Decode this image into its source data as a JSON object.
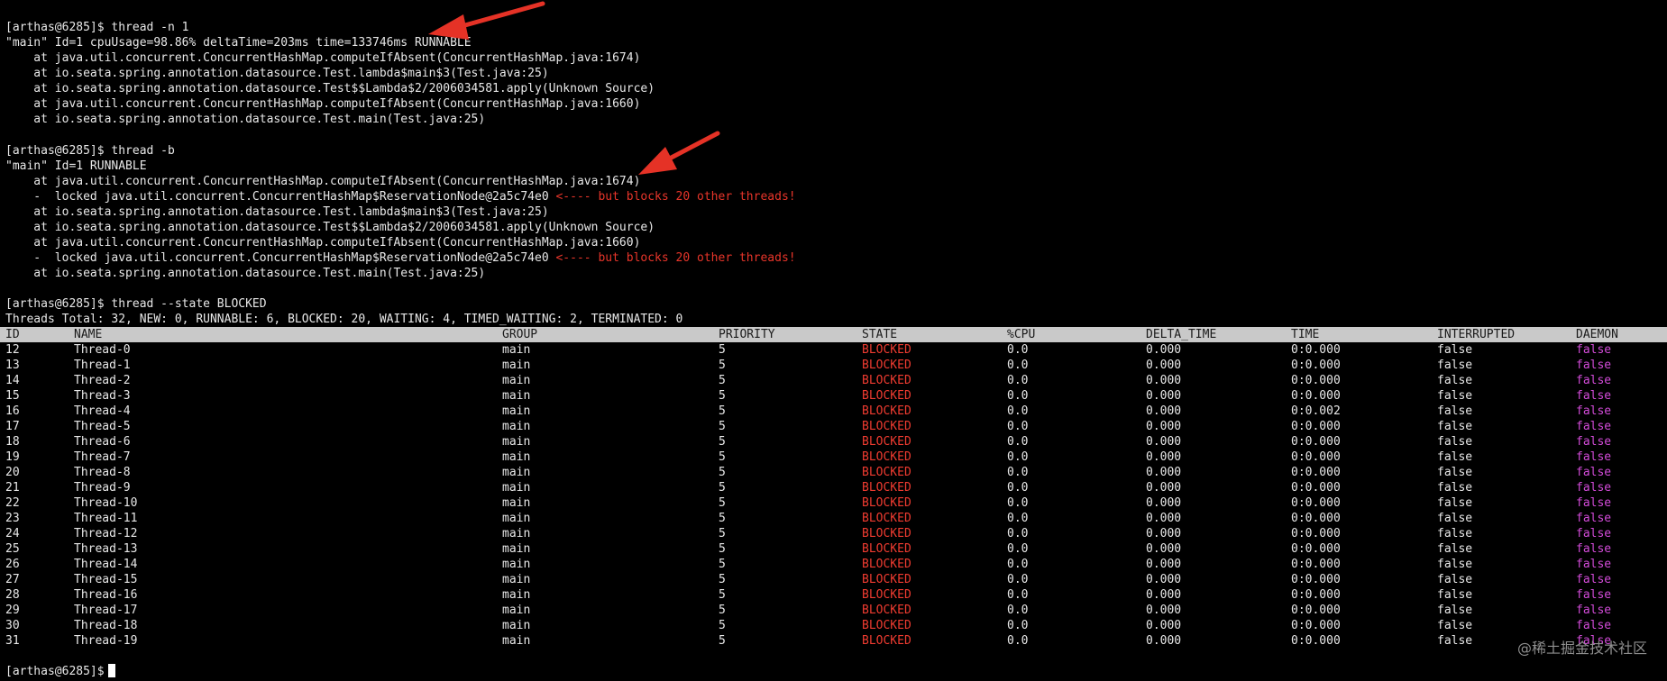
{
  "terminal": {
    "section1": {
      "prompt": "[arthas@6285]$ thread -n 1",
      "lines": [
        "\"main\" Id=1 cpuUsage=98.86% deltaTime=203ms time=133746ms RUNNABLE",
        "    at java.util.concurrent.ConcurrentHashMap.computeIfAbsent(ConcurrentHashMap.java:1674)",
        "    at io.seata.spring.annotation.datasource.Test.lambda$main$3(Test.java:25)",
        "    at io.seata.spring.annotation.datasource.Test$$Lambda$2/2006034581.apply(Unknown Source)",
        "    at java.util.concurrent.ConcurrentHashMap.computeIfAbsent(ConcurrentHashMap.java:1660)",
        "    at io.seata.spring.annotation.datasource.Test.main(Test.java:25)"
      ]
    },
    "section2": {
      "prompt": "[arthas@6285]$ thread -b",
      "line0": "\"main\" Id=1 RUNNABLE",
      "line1": "    at java.util.concurrent.ConcurrentHashMap.computeIfAbsent(ConcurrentHashMap.java:1674)",
      "line2": "    -  locked java.util.concurrent.ConcurrentHashMap$ReservationNode@2a5c74e0 ",
      "line2_warn": "<---- but blocks 20 other threads!",
      "line3": "    at io.seata.spring.annotation.datasource.Test.lambda$main$3(Test.java:25)",
      "line4": "    at io.seata.spring.annotation.datasource.Test$$Lambda$2/2006034581.apply(Unknown Source)",
      "line5": "    at java.util.concurrent.ConcurrentHashMap.computeIfAbsent(ConcurrentHashMap.java:1660)",
      "line6": "    -  locked java.util.concurrent.ConcurrentHashMap$ReservationNode@2a5c74e0 ",
      "line6_warn": "<---- but blocks 20 other threads!",
      "line7": "    at io.seata.spring.annotation.datasource.Test.main(Test.java:25)"
    },
    "section3": {
      "prompt": "[arthas@6285]$ thread --state BLOCKED",
      "summary": "Threads Total: 32, NEW: 0, RUNNABLE: 6, BLOCKED: 20, WAITING: 4, TIMED_WAITING: 2, TERMINATED: 0"
    },
    "final_prompt": "[arthas@6285]$"
  },
  "table": {
    "headers": [
      "ID",
      "NAME",
      "GROUP",
      "PRIORITY",
      "STATE",
      "%CPU",
      "DELTA_TIME",
      "TIME",
      "INTERRUPTED",
      "DAEMON"
    ],
    "rows": [
      [
        "12",
        "Thread-0",
        "main",
        "5",
        "BLOCKED",
        "0.0",
        "0.000",
        "0:0.000",
        "false",
        "false"
      ],
      [
        "13",
        "Thread-1",
        "main",
        "5",
        "BLOCKED",
        "0.0",
        "0.000",
        "0:0.000",
        "false",
        "false"
      ],
      [
        "14",
        "Thread-2",
        "main",
        "5",
        "BLOCKED",
        "0.0",
        "0.000",
        "0:0.000",
        "false",
        "false"
      ],
      [
        "15",
        "Thread-3",
        "main",
        "5",
        "BLOCKED",
        "0.0",
        "0.000",
        "0:0.000",
        "false",
        "false"
      ],
      [
        "16",
        "Thread-4",
        "main",
        "5",
        "BLOCKED",
        "0.0",
        "0.000",
        "0:0.002",
        "false",
        "false"
      ],
      [
        "17",
        "Thread-5",
        "main",
        "5",
        "BLOCKED",
        "0.0",
        "0.000",
        "0:0.000",
        "false",
        "false"
      ],
      [
        "18",
        "Thread-6",
        "main",
        "5",
        "BLOCKED",
        "0.0",
        "0.000",
        "0:0.000",
        "false",
        "false"
      ],
      [
        "19",
        "Thread-7",
        "main",
        "5",
        "BLOCKED",
        "0.0",
        "0.000",
        "0:0.000",
        "false",
        "false"
      ],
      [
        "20",
        "Thread-8",
        "main",
        "5",
        "BLOCKED",
        "0.0",
        "0.000",
        "0:0.000",
        "false",
        "false"
      ],
      [
        "21",
        "Thread-9",
        "main",
        "5",
        "BLOCKED",
        "0.0",
        "0.000",
        "0:0.000",
        "false",
        "false"
      ],
      [
        "22",
        "Thread-10",
        "main",
        "5",
        "BLOCKED",
        "0.0",
        "0.000",
        "0:0.000",
        "false",
        "false"
      ],
      [
        "23",
        "Thread-11",
        "main",
        "5",
        "BLOCKED",
        "0.0",
        "0.000",
        "0:0.000",
        "false",
        "false"
      ],
      [
        "24",
        "Thread-12",
        "main",
        "5",
        "BLOCKED",
        "0.0",
        "0.000",
        "0:0.000",
        "false",
        "false"
      ],
      [
        "25",
        "Thread-13",
        "main",
        "5",
        "BLOCKED",
        "0.0",
        "0.000",
        "0:0.000",
        "false",
        "false"
      ],
      [
        "26",
        "Thread-14",
        "main",
        "5",
        "BLOCKED",
        "0.0",
        "0.000",
        "0:0.000",
        "false",
        "false"
      ],
      [
        "27",
        "Thread-15",
        "main",
        "5",
        "BLOCKED",
        "0.0",
        "0.000",
        "0:0.000",
        "false",
        "false"
      ],
      [
        "28",
        "Thread-16",
        "main",
        "5",
        "BLOCKED",
        "0.0",
        "0.000",
        "0:0.000",
        "false",
        "false"
      ],
      [
        "29",
        "Thread-17",
        "main",
        "5",
        "BLOCKED",
        "0.0",
        "0.000",
        "0:0.000",
        "false",
        "false"
      ],
      [
        "30",
        "Thread-18",
        "main",
        "5",
        "BLOCKED",
        "0.0",
        "0.000",
        "0:0.000",
        "false",
        "false"
      ],
      [
        "31",
        "Thread-19",
        "main",
        "5",
        "BLOCKED",
        "0.0",
        "0.000",
        "0:0.000",
        "false",
        "false"
      ]
    ]
  },
  "watermark": "@稀土掘金技术社区",
  "colors": {
    "background": "#000000",
    "text": "#e8e8e8",
    "warning_red": "#e8352a",
    "blocked_red": "#ef3b30",
    "daemon_magenta": "#d24bd8",
    "header_bar": "#c9c9c9",
    "arrow_red": "#e53226"
  },
  "icons": {
    "annotation_arrow": "red-arrow-icon",
    "cursor": "block-cursor"
  }
}
